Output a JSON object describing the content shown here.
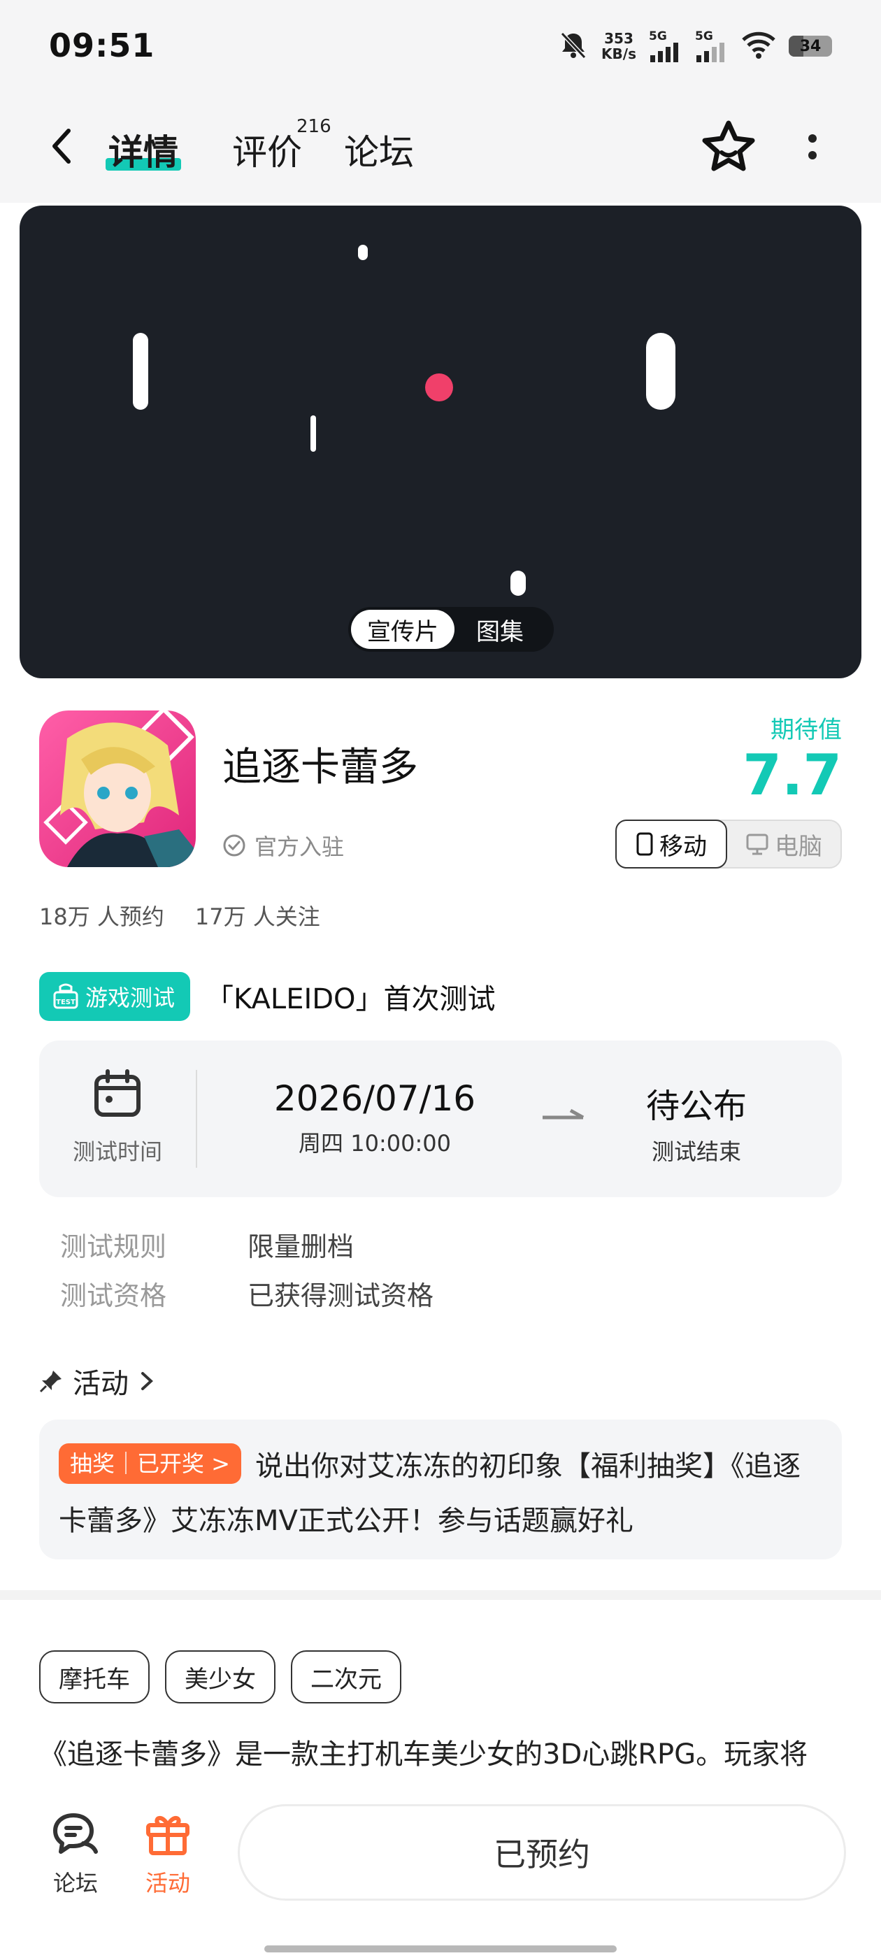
{
  "status_bar": {
    "time": "09:51",
    "speed_value": "353",
    "speed_unit": "KB/s",
    "sim1": "5G",
    "sim2": "5G",
    "battery": "34"
  },
  "nav": {
    "tab_detail": "详情",
    "tab_review": "评价",
    "review_count": "216",
    "tab_forum": "论坛"
  },
  "media": {
    "tab_video": "宣传片",
    "tab_gallery": "图集"
  },
  "game": {
    "title": "追逐卡蕾多",
    "verified": "官方入驻",
    "expect_label": "期待值",
    "expect_score": "7.7",
    "platform_mobile": "移动",
    "platform_pc": "电脑",
    "reservations": "18万 人预约",
    "followers": "17万 人关注"
  },
  "test": {
    "badge": "游戏测试",
    "badge_icon_text": "TEST",
    "title": "「KALEIDO」首次测试",
    "time_label": "测试时间",
    "start_date": "2026/07/16",
    "start_sub": "周四  10:00:00",
    "end_value": "待公布",
    "end_sub": "测试结束",
    "rules": [
      {
        "key": "测试规则",
        "value": "限量删档"
      },
      {
        "key": "测试资格",
        "value": "已获得测试资格"
      }
    ]
  },
  "activity": {
    "header": "活动",
    "badge": "抽奖｜已开奖 >",
    "text": "说出你对艾冻冻的初印象【福利抽奖】《追逐卡蕾多》艾冻冻MV正式公开！参与话题赢好礼"
  },
  "tags": [
    "摩托车",
    "美少女",
    "二次元"
  ],
  "description": "《追逐卡蕾多》是一款主打机车美少女的3D心跳RPG。玩家将",
  "bottom": {
    "forum": "论坛",
    "activity": "活动",
    "reserve_button": "已预约"
  },
  "colors": {
    "accent": "#13c9b5",
    "orange": "#ff6b35",
    "media_bg": "#1c2027"
  }
}
